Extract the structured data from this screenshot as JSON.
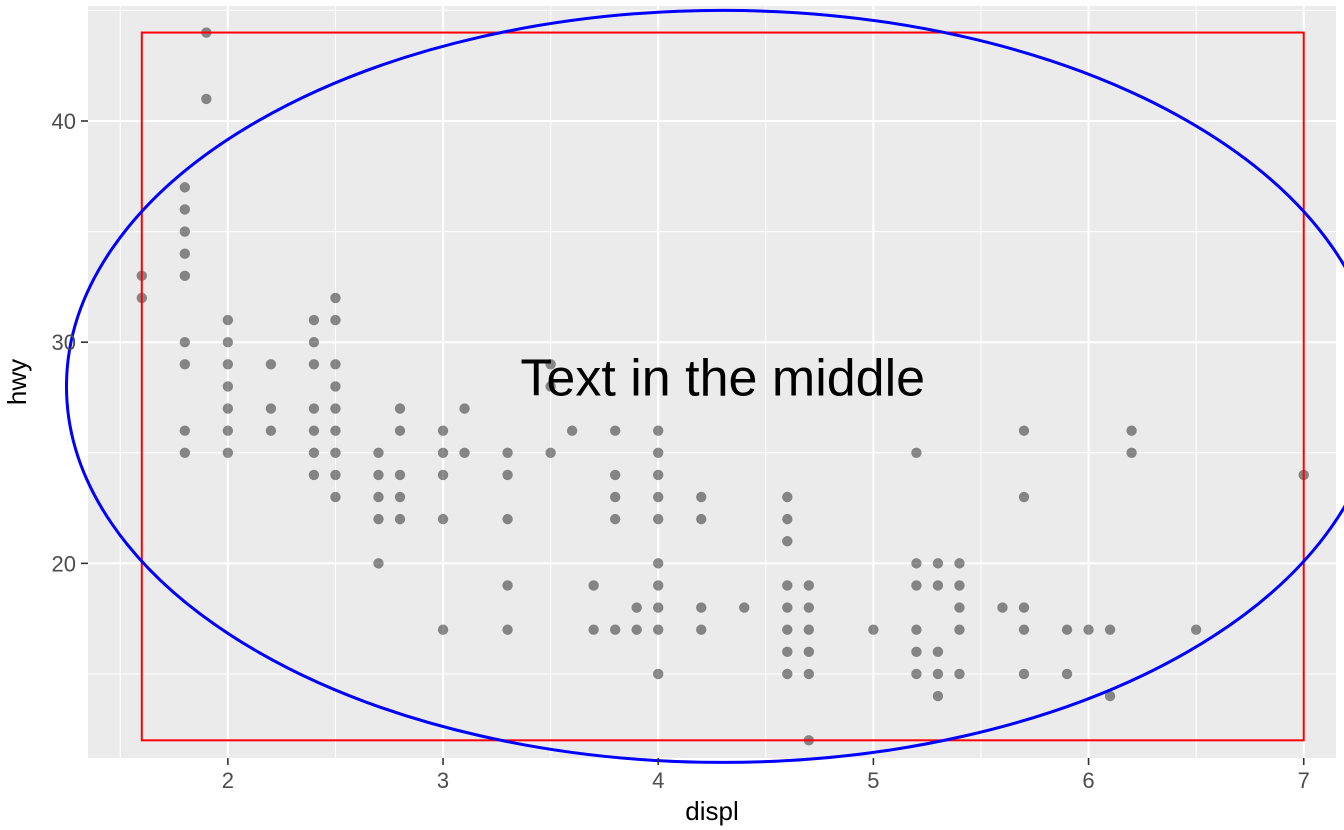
{
  "chart_data": {
    "type": "scatter",
    "xlabel": "displ",
    "ylabel": "hwy",
    "xlim": [
      1.35,
      7.15
    ],
    "ylim": [
      11.2,
      45.2
    ],
    "x_ticks": [
      2,
      3,
      4,
      5,
      6,
      7
    ],
    "y_ticks": [
      20,
      30,
      40
    ],
    "x_minor": [
      1.5,
      2.5,
      3.5,
      4.5,
      5.5,
      6.5
    ],
    "y_minor": [
      15,
      25,
      35,
      45
    ],
    "annotations": {
      "rect": {
        "xmin": 1.6,
        "xmax": 7.0,
        "ymin": 12,
        "ymax": 44,
        "color": "#ff0000"
      },
      "ellipse": {
        "cx": 4.3,
        "cy": 28.0,
        "rx": 3.05,
        "ry": 17.0,
        "color": "#0000ff"
      },
      "text": {
        "x": 4.3,
        "y": 28.2,
        "label": "Text in the middle"
      }
    },
    "points": [
      {
        "x": 1.6,
        "y": 32
      },
      {
        "x": 1.6,
        "y": 33
      },
      {
        "x": 1.8,
        "y": 25
      },
      {
        "x": 1.8,
        "y": 26
      },
      {
        "x": 1.8,
        "y": 29
      },
      {
        "x": 1.8,
        "y": 30
      },
      {
        "x": 1.8,
        "y": 33
      },
      {
        "x": 1.8,
        "y": 34
      },
      {
        "x": 1.8,
        "y": 35
      },
      {
        "x": 1.8,
        "y": 36
      },
      {
        "x": 1.8,
        "y": 37
      },
      {
        "x": 1.9,
        "y": 41
      },
      {
        "x": 1.9,
        "y": 44
      },
      {
        "x": 2.0,
        "y": 25
      },
      {
        "x": 2.0,
        "y": 26
      },
      {
        "x": 2.0,
        "y": 27
      },
      {
        "x": 2.0,
        "y": 28
      },
      {
        "x": 2.0,
        "y": 29
      },
      {
        "x": 2.0,
        "y": 30
      },
      {
        "x": 2.0,
        "y": 31
      },
      {
        "x": 2.2,
        "y": 26
      },
      {
        "x": 2.2,
        "y": 27
      },
      {
        "x": 2.2,
        "y": 29
      },
      {
        "x": 2.4,
        "y": 24
      },
      {
        "x": 2.4,
        "y": 25
      },
      {
        "x": 2.4,
        "y": 26
      },
      {
        "x": 2.4,
        "y": 27
      },
      {
        "x": 2.4,
        "y": 29
      },
      {
        "x": 2.4,
        "y": 30
      },
      {
        "x": 2.4,
        "y": 31
      },
      {
        "x": 2.5,
        "y": 23
      },
      {
        "x": 2.5,
        "y": 24
      },
      {
        "x": 2.5,
        "y": 25
      },
      {
        "x": 2.5,
        "y": 26
      },
      {
        "x": 2.5,
        "y": 27
      },
      {
        "x": 2.5,
        "y": 28
      },
      {
        "x": 2.5,
        "y": 29
      },
      {
        "x": 2.5,
        "y": 31
      },
      {
        "x": 2.5,
        "y": 32
      },
      {
        "x": 2.7,
        "y": 20
      },
      {
        "x": 2.7,
        "y": 22
      },
      {
        "x": 2.7,
        "y": 23
      },
      {
        "x": 2.7,
        "y": 24
      },
      {
        "x": 2.7,
        "y": 25
      },
      {
        "x": 2.8,
        "y": 22
      },
      {
        "x": 2.8,
        "y": 23
      },
      {
        "x": 2.8,
        "y": 24
      },
      {
        "x": 2.8,
        "y": 26
      },
      {
        "x": 2.8,
        "y": 27
      },
      {
        "x": 3.0,
        "y": 17
      },
      {
        "x": 3.0,
        "y": 22
      },
      {
        "x": 3.0,
        "y": 24
      },
      {
        "x": 3.0,
        "y": 25
      },
      {
        "x": 3.0,
        "y": 26
      },
      {
        "x": 3.1,
        "y": 25
      },
      {
        "x": 3.1,
        "y": 27
      },
      {
        "x": 3.3,
        "y": 17
      },
      {
        "x": 3.3,
        "y": 19
      },
      {
        "x": 3.3,
        "y": 22
      },
      {
        "x": 3.3,
        "y": 24
      },
      {
        "x": 3.3,
        "y": 25
      },
      {
        "x": 3.5,
        "y": 25
      },
      {
        "x": 3.5,
        "y": 28
      },
      {
        "x": 3.5,
        "y": 29
      },
      {
        "x": 3.6,
        "y": 26
      },
      {
        "x": 3.7,
        "y": 17
      },
      {
        "x": 3.7,
        "y": 19
      },
      {
        "x": 3.8,
        "y": 17
      },
      {
        "x": 3.8,
        "y": 22
      },
      {
        "x": 3.8,
        "y": 23
      },
      {
        "x": 3.8,
        "y": 24
      },
      {
        "x": 3.8,
        "y": 26
      },
      {
        "x": 3.9,
        "y": 17
      },
      {
        "x": 3.9,
        "y": 18
      },
      {
        "x": 4.0,
        "y": 15
      },
      {
        "x": 4.0,
        "y": 17
      },
      {
        "x": 4.0,
        "y": 18
      },
      {
        "x": 4.0,
        "y": 19
      },
      {
        "x": 4.0,
        "y": 20
      },
      {
        "x": 4.0,
        "y": 22
      },
      {
        "x": 4.0,
        "y": 23
      },
      {
        "x": 4.0,
        "y": 24
      },
      {
        "x": 4.0,
        "y": 25
      },
      {
        "x": 4.0,
        "y": 26
      },
      {
        "x": 4.2,
        "y": 17
      },
      {
        "x": 4.2,
        "y": 18
      },
      {
        "x": 4.2,
        "y": 22
      },
      {
        "x": 4.2,
        "y": 23
      },
      {
        "x": 4.4,
        "y": 18
      },
      {
        "x": 4.6,
        "y": 15
      },
      {
        "x": 4.6,
        "y": 16
      },
      {
        "x": 4.6,
        "y": 17
      },
      {
        "x": 4.6,
        "y": 18
      },
      {
        "x": 4.6,
        "y": 19
      },
      {
        "x": 4.6,
        "y": 21
      },
      {
        "x": 4.6,
        "y": 22
      },
      {
        "x": 4.6,
        "y": 23
      },
      {
        "x": 4.7,
        "y": 12
      },
      {
        "x": 4.7,
        "y": 15
      },
      {
        "x": 4.7,
        "y": 16
      },
      {
        "x": 4.7,
        "y": 17
      },
      {
        "x": 4.7,
        "y": 18
      },
      {
        "x": 4.7,
        "y": 19
      },
      {
        "x": 5.0,
        "y": 17
      },
      {
        "x": 5.2,
        "y": 15
      },
      {
        "x": 5.2,
        "y": 16
      },
      {
        "x": 5.2,
        "y": 17
      },
      {
        "x": 5.2,
        "y": 19
      },
      {
        "x": 5.2,
        "y": 20
      },
      {
        "x": 5.2,
        "y": 25
      },
      {
        "x": 5.3,
        "y": 14
      },
      {
        "x": 5.3,
        "y": 15
      },
      {
        "x": 5.3,
        "y": 16
      },
      {
        "x": 5.3,
        "y": 19
      },
      {
        "x": 5.3,
        "y": 20
      },
      {
        "x": 5.4,
        "y": 15
      },
      {
        "x": 5.4,
        "y": 17
      },
      {
        "x": 5.4,
        "y": 18
      },
      {
        "x": 5.4,
        "y": 19
      },
      {
        "x": 5.4,
        "y": 20
      },
      {
        "x": 5.6,
        "y": 18
      },
      {
        "x": 5.7,
        "y": 15
      },
      {
        "x": 5.7,
        "y": 17
      },
      {
        "x": 5.7,
        "y": 18
      },
      {
        "x": 5.7,
        "y": 23
      },
      {
        "x": 5.7,
        "y": 26
      },
      {
        "x": 5.9,
        "y": 15
      },
      {
        "x": 5.9,
        "y": 17
      },
      {
        "x": 6.0,
        "y": 17
      },
      {
        "x": 6.1,
        "y": 14
      },
      {
        "x": 6.1,
        "y": 17
      },
      {
        "x": 6.2,
        "y": 25
      },
      {
        "x": 6.2,
        "y": 26
      },
      {
        "x": 6.5,
        "y": 17
      },
      {
        "x": 7.0,
        "y": 24
      }
    ]
  },
  "labels": {
    "center_text": "Text in the middle",
    "xlabel": "displ",
    "ylabel": "hwy",
    "xticks": {
      "t2": "2",
      "t3": "3",
      "t4": "4",
      "t5": "5",
      "t6": "6",
      "t7": "7"
    },
    "yticks": {
      "t20": "20",
      "t30": "30",
      "t40": "40"
    }
  }
}
